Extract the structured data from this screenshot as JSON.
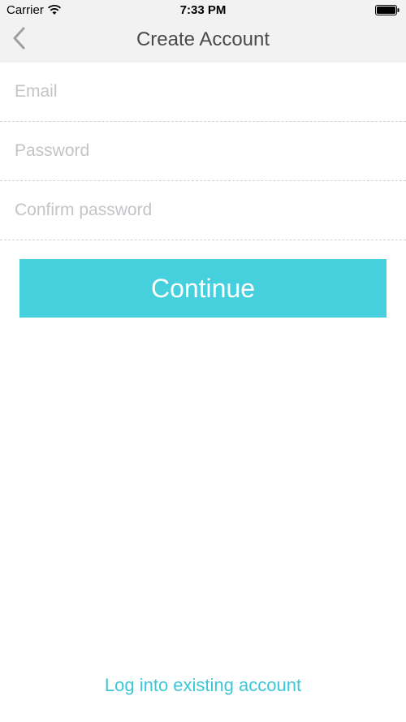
{
  "status_bar": {
    "carrier": "Carrier",
    "time": "7:33 PM"
  },
  "nav": {
    "title": "Create Account",
    "back_icon": "chevron-left-icon"
  },
  "form": {
    "email_placeholder": "Email",
    "email_value": "",
    "password_placeholder": "Password",
    "password_value": "",
    "confirm_placeholder": "Confirm password",
    "confirm_value": ""
  },
  "continue_label": "Continue",
  "login_link": "Log into existing account",
  "colors": {
    "accent": "#46d0dd",
    "link": "#3cc7d6",
    "topbar_bg": "#f2f2f2",
    "title_text": "#4a4a4a",
    "placeholder": "#c4c4c8"
  }
}
